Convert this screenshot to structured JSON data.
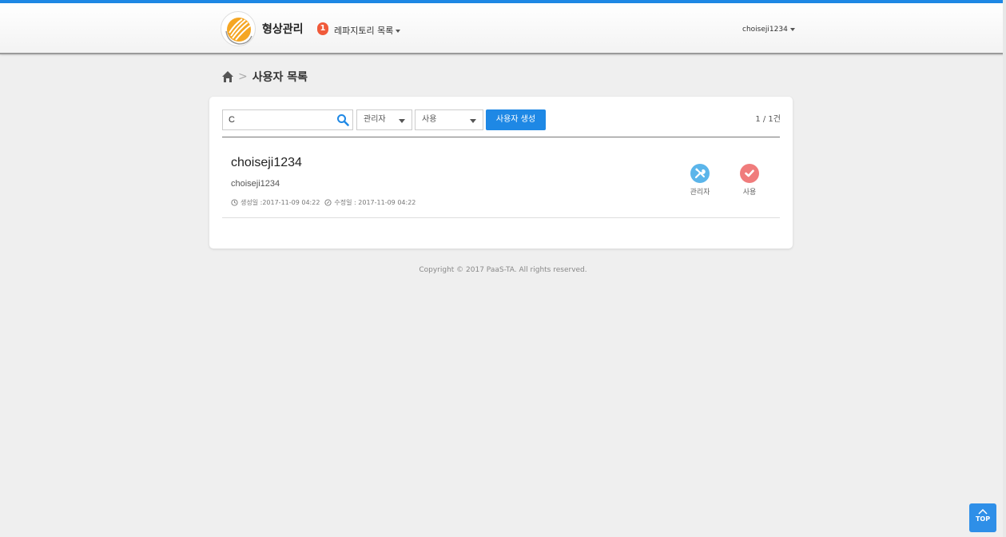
{
  "header": {
    "brand": "형상관리",
    "repo_badge": "1",
    "repo_menu_label": "레파지토리 목록",
    "user_menu_label": "choiseji1234"
  },
  "breadcrumb": {
    "page_title": "사용자 목록"
  },
  "toolbar": {
    "search_value": "C",
    "role_select": "관리자",
    "status_select": "사용",
    "create_button": "사용자 생성",
    "count_text": "1 / 1건"
  },
  "users": [
    {
      "name": "choiseji1234",
      "id": "choiseji1234",
      "created_text": "생성일 :2017-11-09 04:22",
      "modified_text": "수정일 : 2017-11-09 04:22",
      "role_label": "관리자",
      "status_label": "사용"
    }
  ],
  "footer": {
    "copyright": "Copyright © 2017 PaaS-TA. All rights reserved."
  },
  "top_button": {
    "label": "TOP"
  },
  "colors": {
    "accent": "#1e88e5",
    "badge": "#f05a3a",
    "role_icon": "#5bb5ea",
    "status_icon": "#f07c7c"
  }
}
